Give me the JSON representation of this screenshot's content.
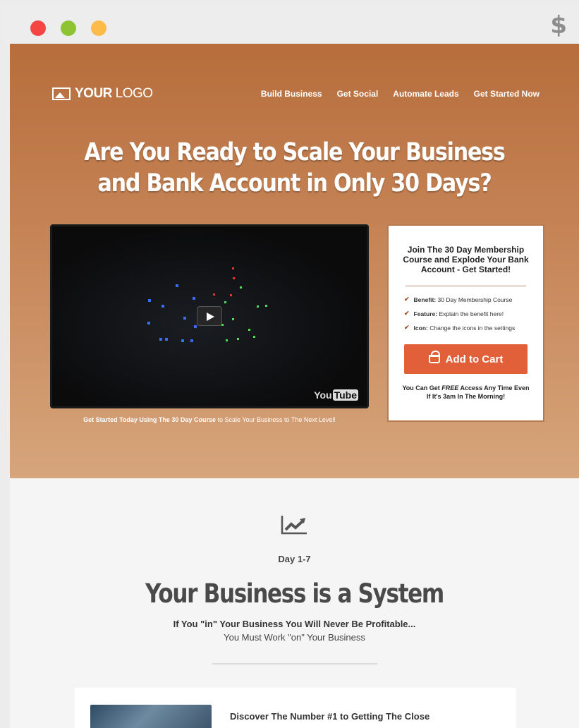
{
  "browser": {
    "icon": "dollar-icon",
    "icon_glyph": "$"
  },
  "header": {
    "logo_bold": "YOUR",
    "logo_light": " LOGO",
    "nav": [
      "Build Business",
      "Get Social",
      "Automate Leads",
      "Get Started Now"
    ]
  },
  "hero": {
    "headline_line1": "Are You Ready to Scale Your Business",
    "headline_line2": "and Bank Account in Only 30 Days?",
    "video": {
      "logo_you": "You",
      "logo_tube": "Tube"
    },
    "caption_bold": "Get Started Today Using The 30 Day Course",
    "caption_rest": " to Scale Your Business to The Next Level!"
  },
  "optin": {
    "title": "Join The 30 Day Membership Course and Explode Your Bank Account - Get Started!",
    "benefits": [
      {
        "label": "Benefit:",
        "text": " 30 Day Membership Course"
      },
      {
        "label": "Feature:",
        "text": " Explain the benefit here!"
      },
      {
        "label": "Icon:",
        "text": " Change the icons in the settings"
      }
    ],
    "cart_label": "Add to Cart",
    "note_pre": "You Can Get ",
    "note_free": "FREE",
    "note_post": " Access Any Time Even If It's 3am In The Morning!"
  },
  "section": {
    "day": "Day 1-7",
    "title": "Your Business is a System",
    "sub_bold": "If You \"in\" Your Business You Will Never Be Profitable...",
    "sub_regular": "You Must Work \"on\" Your Business",
    "card_title": "Discover The Number #1 to Getting The Close"
  },
  "colors": {
    "hero_top": "#b76d3c",
    "hero_bottom": "#d6a57c",
    "cart_button": "#e1603a",
    "check": "#a0522d"
  }
}
